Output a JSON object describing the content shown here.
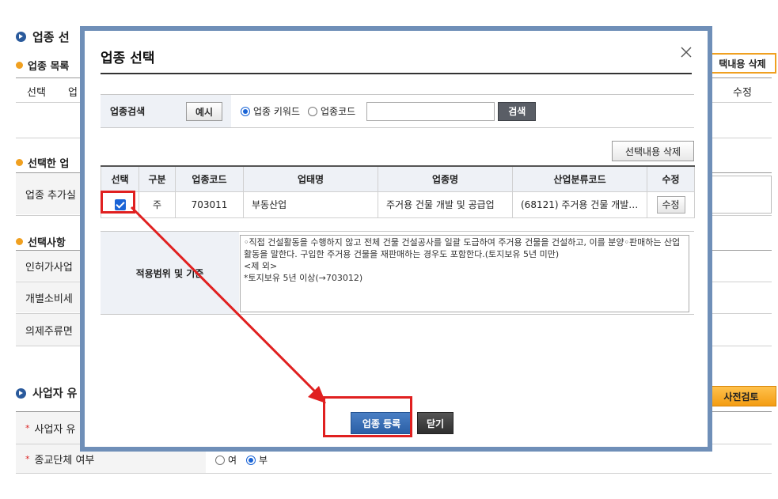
{
  "background": {
    "section_industry_title": "업종 선",
    "industry_list_title": "업종 목록",
    "list_col_select": "선택",
    "list_col_code": "업",
    "list_col_edit": "수정",
    "delete_selected_label": "택내용 삭제",
    "selected_industry_title": "선택한 업",
    "add_industry_label": "업종 추가실",
    "selection_title": "선택사항",
    "row_license": "인허가사업",
    "row_excise": "개별소비세",
    "row_liquor": "의제주류면",
    "business_section_title": "사업자 유",
    "precheck_label": "사전검토",
    "row_business": "사업자 유",
    "row_religious": "종교단체 여부",
    "religious_options": [
      "여",
      "부"
    ]
  },
  "modal": {
    "title": "업종 선택",
    "search_label": "업종검색",
    "example_btn": "예시",
    "radio_keyword": "업종 키워드",
    "radio_code": "업종코드",
    "search_value": "",
    "search_btn": "검색",
    "delete_btn": "선택내용 삭제",
    "table_headers": [
      "선택",
      "구분",
      "업종코드",
      "업태명",
      "업종명",
      "산업분류코드",
      "수정"
    ],
    "row": {
      "gubun": "주",
      "code": "703011",
      "category": "부동산업",
      "industry": "주거용 건물 개발 및 공급업",
      "ksic": "(68121) 주거용 건물 개발…",
      "edit": "수정"
    },
    "scope_label": "적용범위 및 기준",
    "scope_text": "◦직접 건설활동을 수행하지 않고 전체 건물 건설공사를 일괄 도급하여 주거용 건물을 건설하고, 이를 분양◦판매하는 산업활동을 말한다. 구입한 주거용 건물을 재판매하는 경우도 포함한다.(토지보유 5년 미만)\n<제 외>\n*토지보유 5년 이상(→703012)",
    "register_btn": "업종 등록",
    "close_btn": "닫기"
  },
  "colors": {
    "modal_border": "#6f8fb8",
    "highlight": "#e02020",
    "primary": "#2b5fa6",
    "accent_orange": "#f39c12"
  }
}
